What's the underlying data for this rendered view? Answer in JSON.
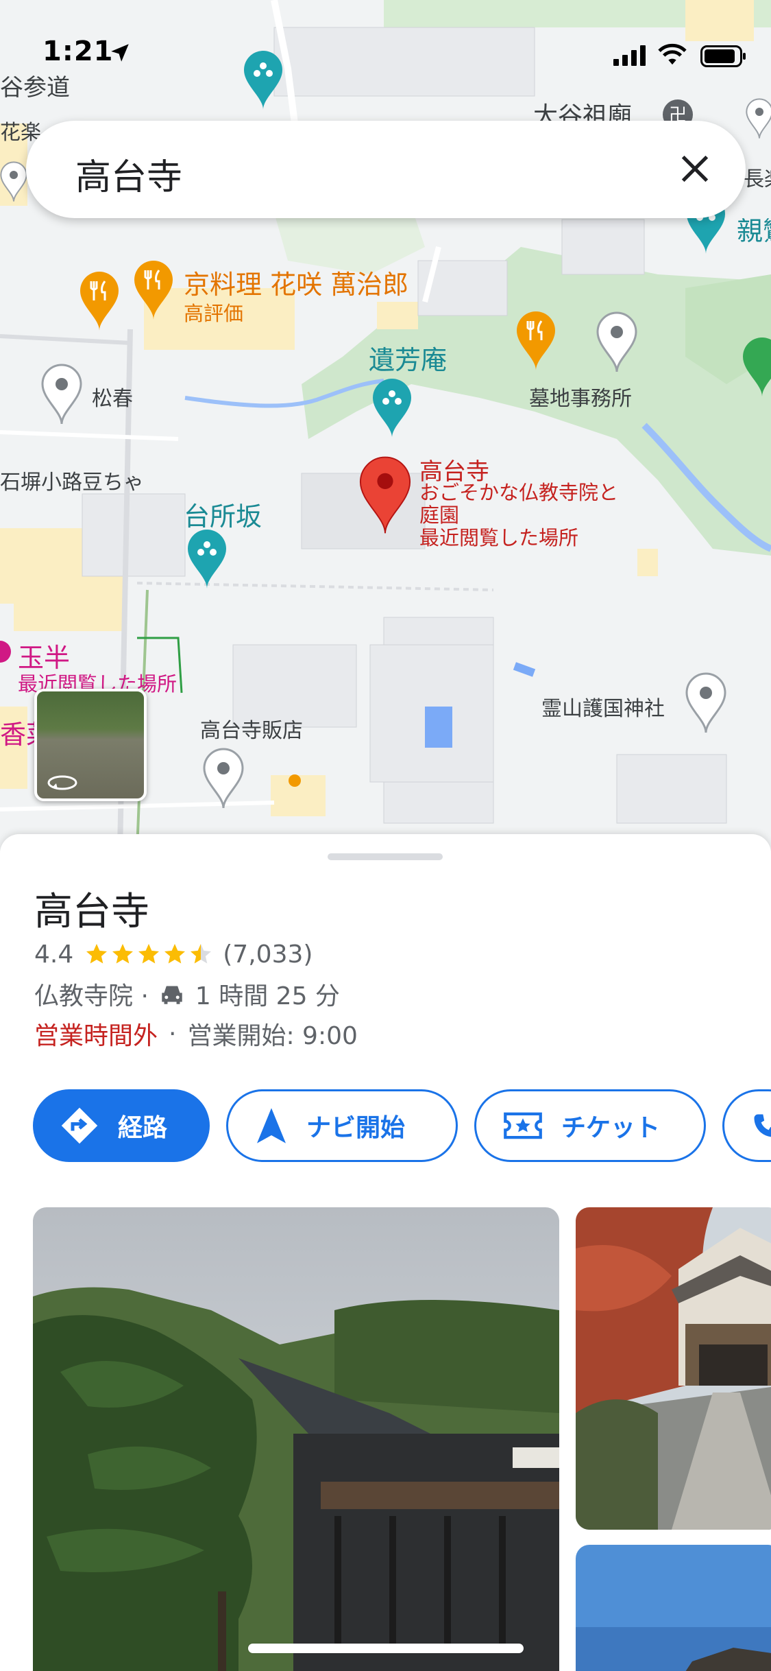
{
  "status_bar": {
    "time": "1:21"
  },
  "search": {
    "query": "高台寺"
  },
  "map": {
    "labels": {
      "restaurant": "京料理 花咲 萬治郎",
      "restaurant_tag": "高評価",
      "ihoan": "遺芳庵",
      "cemetery_office": "墓地事務所",
      "shoshun": "松春",
      "ishibe": "石塀小路豆ちゃ",
      "daidokorozaka": "台所坂",
      "kodaiji_name": "高台寺",
      "kodaiji_desc": "おごそかな仏教寺院と",
      "kodaiji_desc2": "庭園",
      "kodaiji_recent": "最近閲覧した場所",
      "tamahan": "玉半",
      "tamahan_recent": "最近閲覧した場所",
      "shop": "高台寺販店",
      "ryozen": "霊山護国神社",
      "otani": "大谷祖廟",
      "sando": "谷参道",
      "hanaraku": "花楽",
      "nagara": "長楽",
      "shin": "親鸞",
      "ko": "香菜"
    }
  },
  "place": {
    "title": "高台寺",
    "rating": "4.4",
    "stars": 4.4,
    "reviews": "(7,033)",
    "category": "仏教寺院 ·",
    "drive_time": "1 時間 25 分",
    "status_closed": "営業時間外",
    "dot": "·",
    "opening": "営業開始: 9:00"
  },
  "actions": {
    "directions": "経路",
    "navigate": "ナビ開始",
    "tickets": "チケット"
  },
  "colors": {
    "accent": "#1a73e8",
    "pin_red": "#ea4335",
    "closed_red": "#c5221f"
  }
}
